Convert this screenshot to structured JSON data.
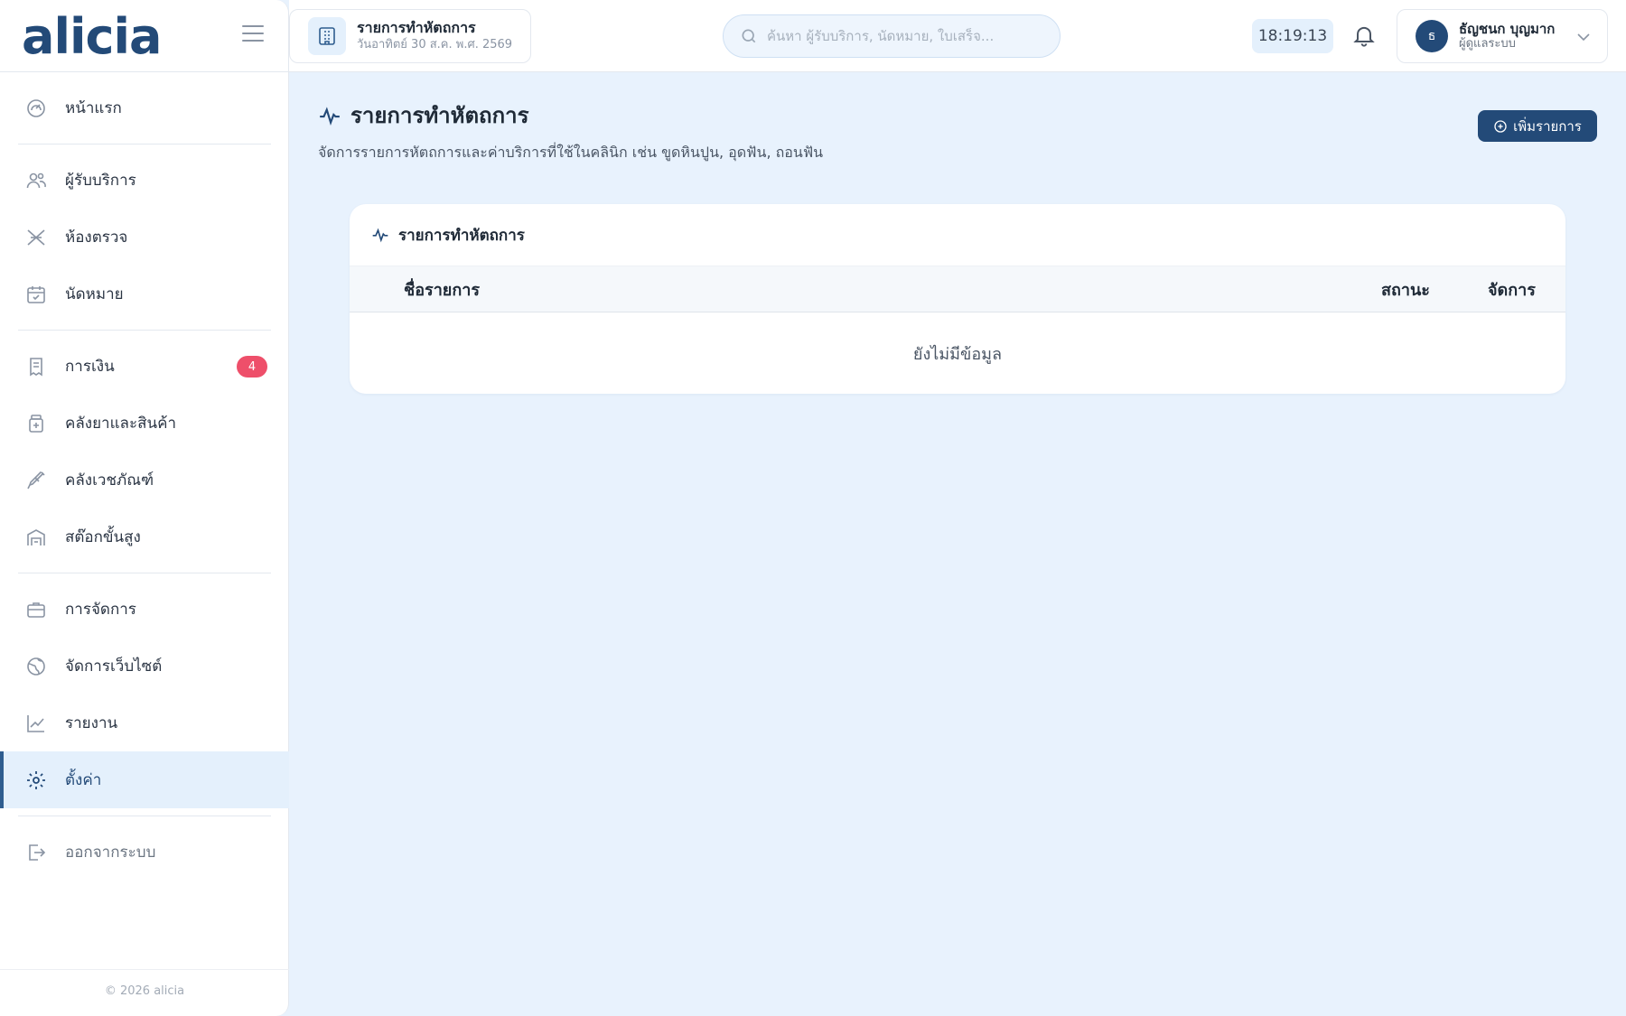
{
  "brand": "alicia",
  "header": {
    "page_title": "รายการทำหัตถการ",
    "page_date": "วันอาทิตย์ 30 ส.ค. พ.ศ. 2569",
    "search_placeholder": "ค้นหา ผู้รับบริการ, นัดหมาย, ใบเสร็จ...",
    "clock": "18:19:13",
    "user": {
      "initial": "ธ",
      "name": "ธัญชนก บุญมาก",
      "role": "ผู้ดูแลระบบ"
    }
  },
  "sidebar": {
    "items": [
      {
        "label": "หน้าแรก",
        "icon": "dashboard-icon"
      },
      {
        "label": "ผู้รับบริการ",
        "icon": "users-icon"
      },
      {
        "label": "ห้องตรวจ",
        "icon": "exam-room-icon"
      },
      {
        "label": "นัดหมาย",
        "icon": "calendar-icon"
      },
      {
        "label": "การเงิน",
        "icon": "receipt-icon",
        "badge": "4"
      },
      {
        "label": "คลังยาและสินค้า",
        "icon": "medicine-icon"
      },
      {
        "label": "คลังเวชภัณฑ์",
        "icon": "syringe-icon"
      },
      {
        "label": "สต๊อกขั้นสูง",
        "icon": "warehouse-icon"
      },
      {
        "label": "การจัดการ",
        "icon": "briefcase-icon"
      },
      {
        "label": "จัดการเว็บไซต์",
        "icon": "globe-icon"
      },
      {
        "label": "รายงาน",
        "icon": "chart-icon"
      },
      {
        "label": "ตั้งค่า",
        "icon": "gear-icon",
        "active": true
      },
      {
        "label": "ออกจากระบบ",
        "icon": "logout-icon"
      }
    ],
    "copyright": "© 2026 alicia"
  },
  "main": {
    "title": "รายการทำหัตถการ",
    "subtitle": "จัดการรายการหัตถการและค่าบริการที่ใช้ในคลินิก เช่น ขูดหินปูน, อุดฟัน, ถอนฟัน",
    "add_button": "เพิ่มรายการ",
    "card": {
      "title": "รายการทำหัตถการ",
      "columns": [
        "ชื่อรายการ",
        "สถานะ",
        "จัดการ"
      ],
      "empty_text": "ยังไม่มีข้อมูล"
    }
  },
  "colors": {
    "accent": "#234a78",
    "background": "#e8f2fd",
    "badge": "#ee4f6a"
  }
}
